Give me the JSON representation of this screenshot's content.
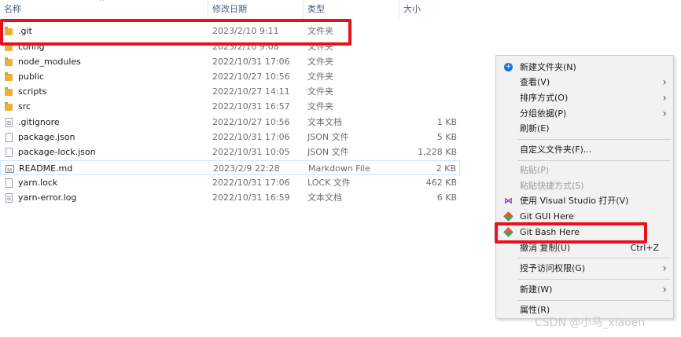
{
  "columns": {
    "name": "名称",
    "date": "修改日期",
    "type": "类型",
    "size": "大小"
  },
  "files": [
    {
      "kind": "folder",
      "name": ".git",
      "date": "2023/2/10 9:11",
      "type": "文件夹",
      "size": ""
    },
    {
      "kind": "folder",
      "name": "config",
      "date": "2023/2/10 9:08",
      "type": "文件夹",
      "size": ""
    },
    {
      "kind": "folder",
      "name": "node_modules",
      "date": "2022/10/31 17:06",
      "type": "文件夹",
      "size": ""
    },
    {
      "kind": "folder",
      "name": "public",
      "date": "2022/10/27 10:56",
      "type": "文件夹",
      "size": ""
    },
    {
      "kind": "folder",
      "name": "scripts",
      "date": "2022/10/27 14:11",
      "type": "文件夹",
      "size": ""
    },
    {
      "kind": "folder",
      "name": "src",
      "date": "2022/10/31 16:57",
      "type": "文件夹",
      "size": ""
    },
    {
      "kind": "file",
      "name": ".gitignore",
      "date": "2022/10/27 10:56",
      "type": "文本文档",
      "size": "1 KB"
    },
    {
      "kind": "file",
      "name": "package.json",
      "date": "2022/10/31 17:06",
      "type": "JSON 文件",
      "size": "5 KB"
    },
    {
      "kind": "file",
      "name": "package-lock.json",
      "date": "2022/10/31 10:05",
      "type": "JSON 文件",
      "size": "1,228 KB"
    },
    {
      "kind": "md",
      "name": "README.md",
      "date": "2023/2/9 22:28",
      "type": "Markdown File",
      "size": "2 KB"
    },
    {
      "kind": "file",
      "name": "yarn.lock",
      "date": "2022/10/31 17:06",
      "type": "LOCK 文件",
      "size": "462 KB"
    },
    {
      "kind": "file",
      "name": "yarn-error.log",
      "date": "2022/10/31 16:59",
      "type": "文本文档",
      "size": "6 KB"
    }
  ],
  "menu": {
    "new_folder": "新建文件夹(N)",
    "view": "查看(V)",
    "sort": "排序方式(O)",
    "group": "分组依据(P)",
    "refresh": "刷新(E)",
    "customize": "自定义文件夹(F)...",
    "paste": "粘贴(P)",
    "paste_shortcut": "粘贴快捷方式(S)",
    "open_vs": "使用 Visual Studio 打开(V)",
    "git_gui": "Git GUI Here",
    "git_bash": "Git Bash Here",
    "undo": "撤消 复制(U)",
    "undo_shortcut": "Ctrl+Z",
    "grant_access": "授予访问权限(G)",
    "new": "新建(W)",
    "properties": "属性(R)"
  },
  "watermark": "CSDN @小马_xiaoen",
  "colors": {
    "highlight": "#e8121e",
    "folder": "#e8b23a"
  }
}
